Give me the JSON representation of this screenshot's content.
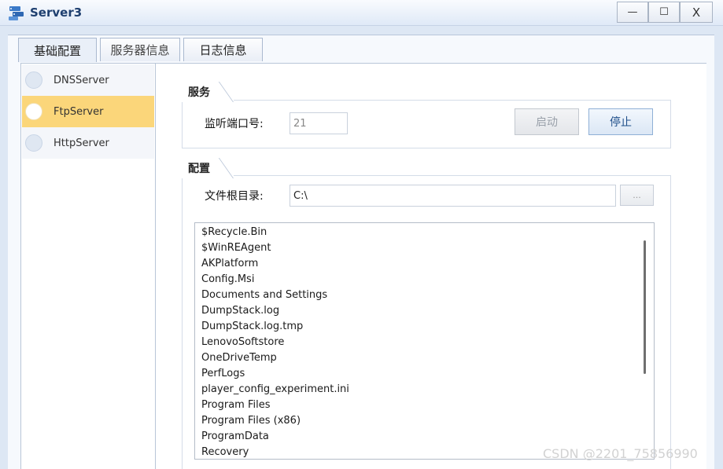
{
  "window": {
    "title": "Server3",
    "controls": {
      "minimize": "—",
      "maximize": "☐",
      "close": "X"
    }
  },
  "tabs": [
    {
      "label": "基础配置",
      "active": true
    },
    {
      "label": "服务器信息",
      "active": false
    },
    {
      "label": "日志信息",
      "active": false
    }
  ],
  "servers": [
    {
      "label": "DNSServer",
      "selected": false
    },
    {
      "label": "FtpServer",
      "selected": true
    },
    {
      "label": "HttpServer",
      "selected": false
    }
  ],
  "service_group": {
    "title": "服务",
    "port_label": "监听端口号:",
    "port_value": "21",
    "start_label": "启动",
    "stop_label": "停止"
  },
  "config_group": {
    "title": "配置",
    "root_label": "文件根目录:",
    "root_value": "C:\\",
    "browse_label": "..."
  },
  "files": [
    "$Recycle.Bin",
    "$WinREAgent",
    "AKPlatform",
    "Config.Msi",
    "Documents and Settings",
    "DumpStack.log",
    "DumpStack.log.tmp",
    "LenovoSoftstore",
    "OneDriveTemp",
    "PerfLogs",
    "player_config_experiment.ini",
    "Program Files",
    "Program Files (x86)",
    "ProgramData",
    "Recovery"
  ],
  "watermark": "CSDN @2201_75856990",
  "colors": {
    "selected_row": "#fbd67a",
    "title_text": "#1e3f6f",
    "frame": "#dde7f4"
  }
}
